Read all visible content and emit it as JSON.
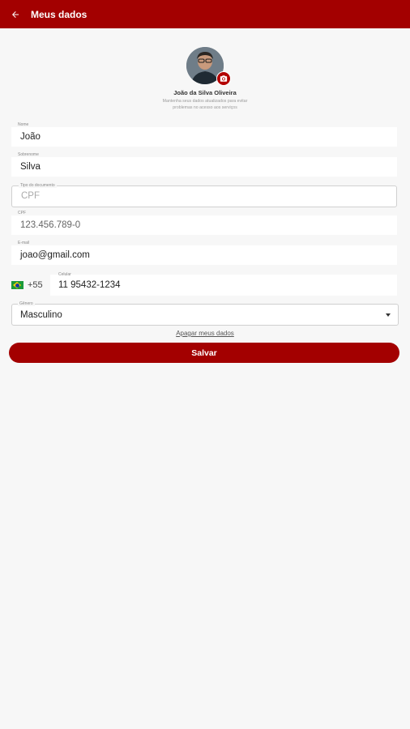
{
  "appbar": {
    "title": "Meus dados"
  },
  "profile": {
    "name": "João da Silva Oliveira",
    "subtitle": "Mantenha seus dados atualizados para evitar problemas no acesso aos serviços"
  },
  "form": {
    "nome": {
      "label": "Nome",
      "value": "João"
    },
    "sobrenome": {
      "label": "Sobrenome",
      "value": "Silva"
    },
    "tipo_documento": {
      "label": "Tipo do documento",
      "value": "CPF"
    },
    "cpf": {
      "label": "CPF",
      "value": "123.456.789-0"
    },
    "email": {
      "label": "E-mail",
      "value": "joao@gmail.com"
    },
    "celular": {
      "country_code": "+55",
      "label": "Celular",
      "value": "11 95432-1234"
    },
    "genero": {
      "label": "Gênero",
      "value": "Masculino"
    }
  },
  "actions": {
    "delete_label": "Apagar meus dados",
    "save_label": "Salvar"
  },
  "colors": {
    "primary": "#a30000",
    "background": "#f7f7f7"
  }
}
